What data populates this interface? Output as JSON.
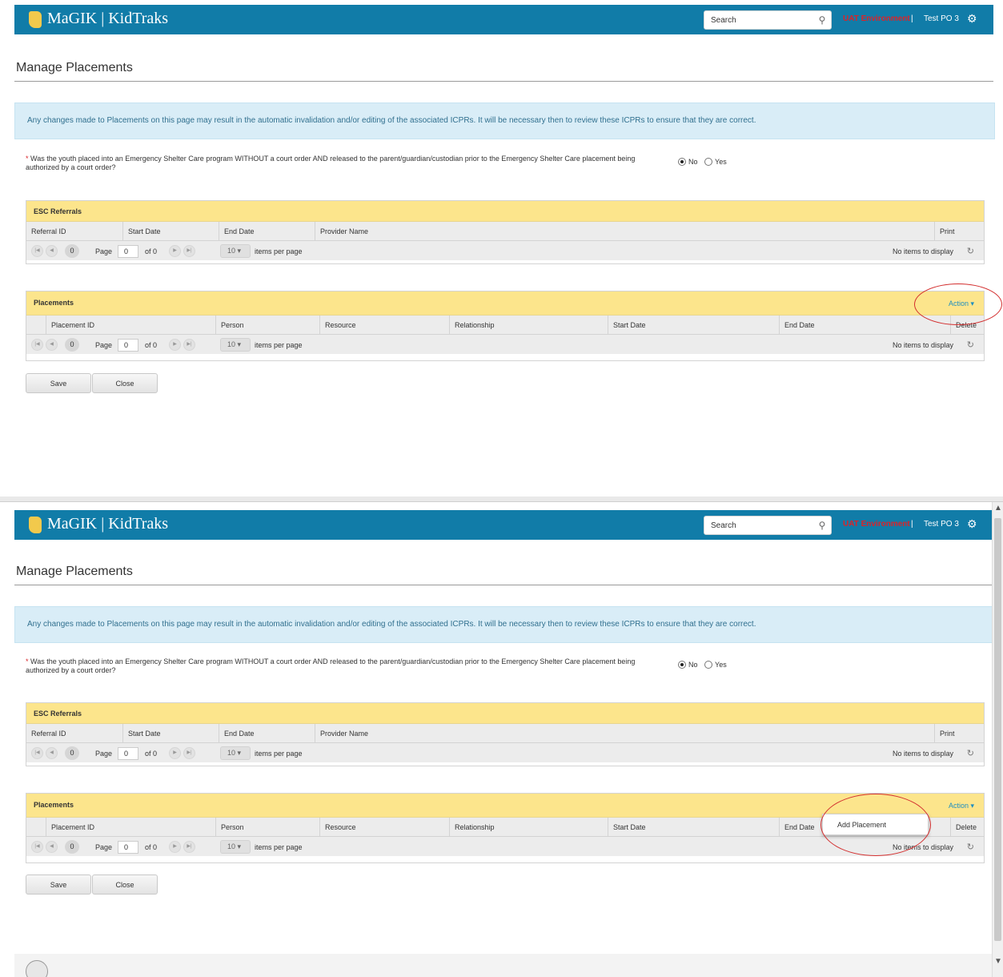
{
  "header": {
    "app_title": "MaGIK | KidTraks",
    "search_placeholder": "Search",
    "environment": "UAT Environment",
    "separator": "|",
    "user": "Test PO 3"
  },
  "page": {
    "title": "Manage Placements",
    "alert": "Any changes made to Placements on this page may result in the automatic invalidation and/or editing of the associated ICPRs. It will be necessary then to review these ICPRs to ensure that they are correct.",
    "question": {
      "required_marker": "*",
      "text": "Was the youth placed into an Emergency Shelter Care program WITHOUT a court order AND released to the parent/guardian/custodian prior to the Emergency Shelter Care placement being authorized by a court order?",
      "options": [
        "No",
        "Yes"
      ],
      "selected": "No"
    }
  },
  "esc_referrals": {
    "title": "ESC Referrals",
    "columns": [
      "Referral ID",
      "Start Date",
      "End Date",
      "Provider Name",
      "Print"
    ]
  },
  "placements": {
    "title": "Placements",
    "action_label": "Action ▾",
    "columns": [
      "Placement ID",
      "Person",
      "Resource",
      "Relationship",
      "Start Date",
      "End Date",
      "Delete"
    ],
    "dropdown_item": "Add Placement"
  },
  "pager": {
    "current": "0",
    "page_label": "Page",
    "page_value": "0",
    "of_label": "of 0",
    "page_size": "10 ▾",
    "per_page_label": "items per page",
    "empty_text": "No items to display"
  },
  "buttons": {
    "save": "Save",
    "close": "Close"
  },
  "colors": {
    "header_bg": "#117ca8",
    "panel_head": "#fce58c",
    "alert_bg": "#d9edf7",
    "environment_text": "#d9242a",
    "annotation": "#d32f2f"
  }
}
